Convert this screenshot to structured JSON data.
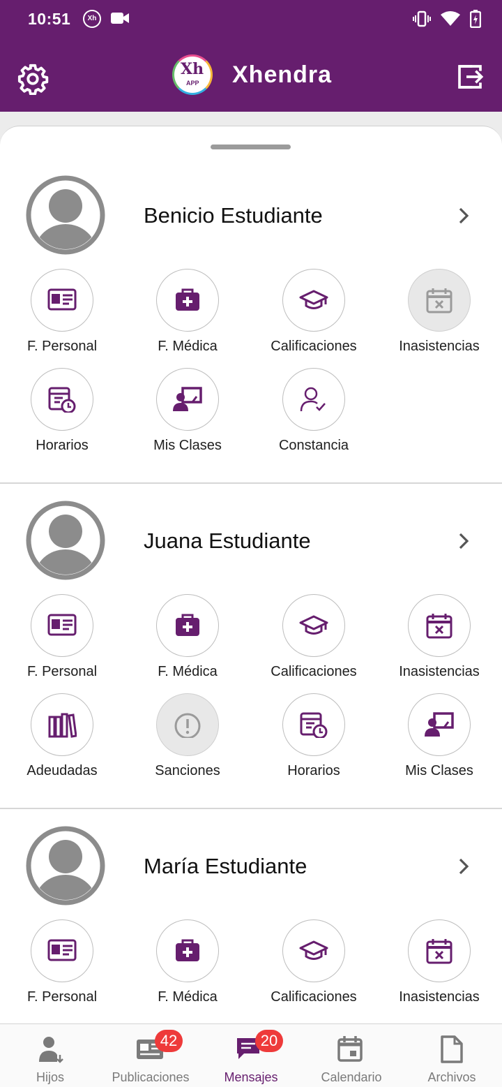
{
  "status_bar": {
    "time": "10:51",
    "icons": [
      "xh-notification-icon",
      "video-camera-icon",
      "vibrate-icon",
      "wifi-icon",
      "battery-charging-icon"
    ]
  },
  "app_bar": {
    "title": "Xhendra",
    "logo_text": "Xh",
    "logo_sub": "APP",
    "settings_icon": "gear-icon",
    "logout_icon": "logout-icon"
  },
  "colors": {
    "primary": "#661e6e",
    "badge": "#ee3a3a",
    "disabled": "#e8e8e8"
  },
  "children": [
    {
      "name": "Benicio Estudiante",
      "tiles": [
        {
          "label": "F. Personal",
          "icon": "id-card-icon",
          "enabled": true
        },
        {
          "label": "F. Médica",
          "icon": "medical-bag-icon",
          "enabled": true
        },
        {
          "label": "Calificaciones",
          "icon": "graduation-cap-icon",
          "enabled": true
        },
        {
          "label": "Inasistencias",
          "icon": "calendar-x-icon",
          "enabled": false
        },
        {
          "label": "Horarios",
          "icon": "schedule-icon",
          "enabled": true
        },
        {
          "label": "Mis Clases",
          "icon": "classroom-icon",
          "enabled": true
        },
        {
          "label": "Constancia",
          "icon": "user-check-icon",
          "enabled": true
        }
      ]
    },
    {
      "name": "Juana Estudiante",
      "tiles": [
        {
          "label": "F. Personal",
          "icon": "id-card-icon",
          "enabled": true
        },
        {
          "label": "F. Médica",
          "icon": "medical-bag-icon",
          "enabled": true
        },
        {
          "label": "Calificaciones",
          "icon": "graduation-cap-icon",
          "enabled": true
        },
        {
          "label": "Inasistencias",
          "icon": "calendar-x-icon",
          "enabled": true
        },
        {
          "label": "Adeudadas",
          "icon": "books-icon",
          "enabled": true
        },
        {
          "label": "Sanciones",
          "icon": "alert-circle-icon",
          "enabled": false
        },
        {
          "label": "Horarios",
          "icon": "schedule-icon",
          "enabled": true
        },
        {
          "label": "Mis Clases",
          "icon": "classroom-icon",
          "enabled": true
        }
      ]
    },
    {
      "name": "María Estudiante",
      "tiles": [
        {
          "label": "F. Personal",
          "icon": "id-card-icon",
          "enabled": true
        },
        {
          "label": "F. Médica",
          "icon": "medical-bag-icon",
          "enabled": true
        },
        {
          "label": "Calificaciones",
          "icon": "graduation-cap-icon",
          "enabled": true
        },
        {
          "label": "Inasistencias",
          "icon": "calendar-x-icon",
          "enabled": true
        }
      ]
    }
  ],
  "bottom_nav": [
    {
      "label": "Hijos",
      "icon": "children-icon",
      "badge": "",
      "active": false
    },
    {
      "label": "Publicaciones",
      "icon": "newspaper-icon",
      "badge": "42",
      "active": false
    },
    {
      "label": "Mensajes",
      "icon": "messages-icon",
      "badge": "20",
      "active": true
    },
    {
      "label": "Calendario",
      "icon": "calendar-icon",
      "badge": "",
      "active": false
    },
    {
      "label": "Archivos",
      "icon": "file-icon",
      "badge": "",
      "active": false
    }
  ]
}
